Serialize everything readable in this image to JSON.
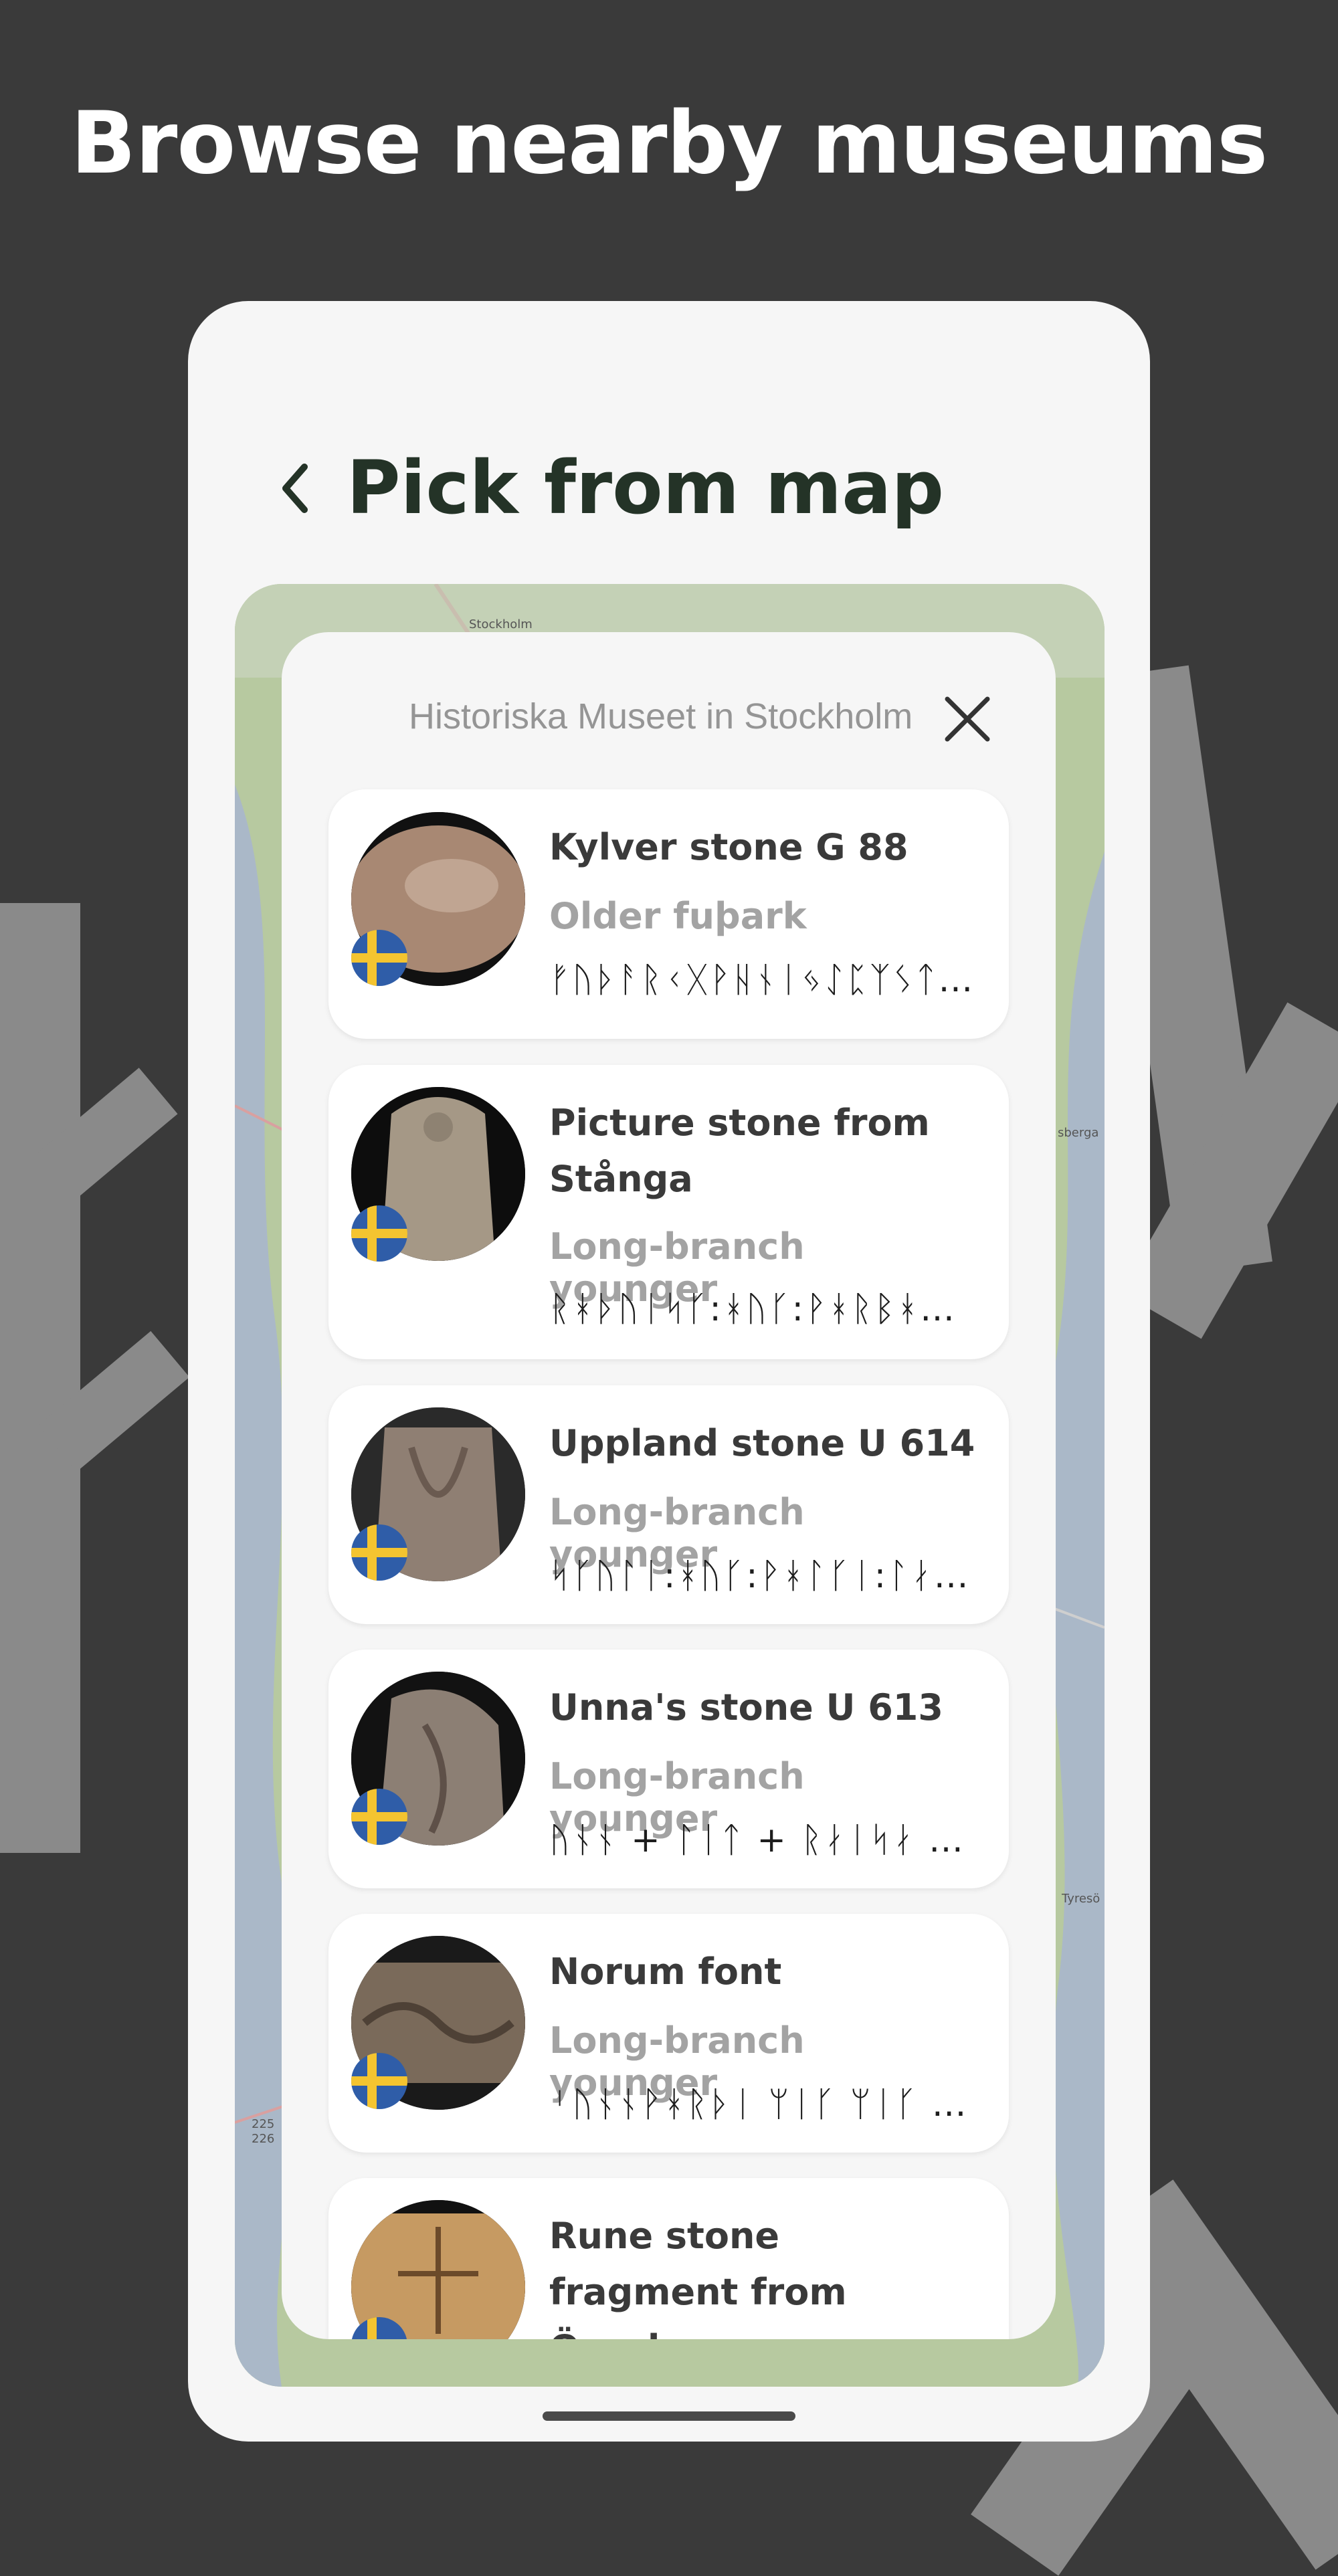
{
  "headline": "Browse nearby museums",
  "screen": {
    "title": "Pick from map",
    "back_icon": "chevron-left-icon"
  },
  "map": {
    "labels": [
      "Stockholm",
      "sberga",
      "Tyresö",
      "225",
      "226"
    ]
  },
  "sheet": {
    "title": "Historiska Museet in Stockholm",
    "close_icon": "close-icon",
    "items": [
      {
        "title": "Kylver stone G 88",
        "script": "Older fuþark",
        "runes": "ᚠᚢᚦᚨᚱᚲᚷᚹᚺᚾᛁᛃᛇᛈᛉᛊᛏᛒᛖᛗ…"
      },
      {
        "title": "Picture stone from Stånga",
        "script": "Long-branch younger",
        "runes": "ᚱᚼᚦᚢᛁᛋᚴ:ᚼᚢᚴ:ᚹᚼᚱᛒᚼᚱᚼ:ᚼ…"
      },
      {
        "title": "Uppland stone U 614",
        "script": "Long-branch younger",
        "runes": "ᛋᚴᚢᛚᛁ:ᚼᚢᚴ:ᚹᚼᛚᚴᛁ:ᛚᛅᛏᛅ:ᚱ…"
      },
      {
        "title": "Unna's stone U 613",
        "script": "Long-branch younger",
        "runes": "ᚢᚾᚾ + ᛚᛁᛏ + ᚱᛅᛁᛋᛅ + ᚦᛁᚾ…"
      },
      {
        "title": "Norum font",
        "script": "Long-branch younger",
        "runes": "ᛌᚢᚾᚾᚹᚼᚱᚦᛁ ᛘᛁᚴ ᛘᛁᚴ ᛘᛁᚴ …"
      },
      {
        "title": "Rune stone fragment from Össeby",
        "script": "",
        "runes": ""
      }
    ]
  },
  "colors": {
    "background": "#3a3a3a",
    "title_text": "#243327",
    "card_title": "#3a3a3a",
    "card_subtitle": "#a3a3a3",
    "flag_blue": "#2f5da8",
    "flag_yellow": "#f4c430"
  }
}
